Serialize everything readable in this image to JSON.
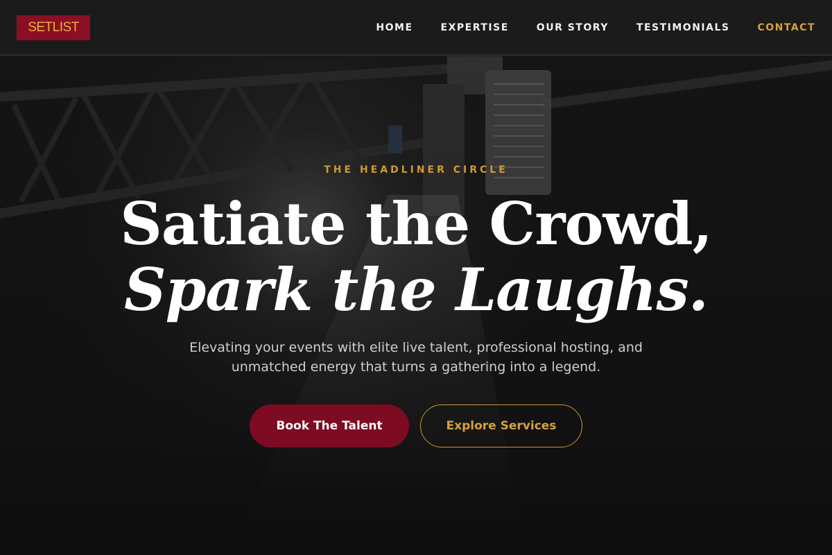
{
  "brand": {
    "logo_text": "SETLIST",
    "colors": {
      "logo_bg": "#8a0f24",
      "logo_text": "#e8b23a",
      "accent_gold": "#d6a13a",
      "primary_button": "#7d0b22",
      "background": "#161616"
    }
  },
  "nav": {
    "items": [
      {
        "label": "HOME",
        "active": false
      },
      {
        "label": "EXPERTISE",
        "active": false
      },
      {
        "label": "OUR STORY",
        "active": false
      },
      {
        "label": "TESTIMONIALS",
        "active": false
      },
      {
        "label": "CONTACT",
        "active": true
      }
    ]
  },
  "hero": {
    "kicker": "THE HEADLINER CIRCLE",
    "headline_line1": "Satiate the Crowd,",
    "headline_line2": "Spark the Laughs.",
    "subtext": "Elevating your events with elite live talent, professional hosting, and unmatched energy that turns a gathering into a legend.",
    "primary_cta": "Book The Talent",
    "secondary_cta": "Explore Services",
    "background_image": "stage-truss-spotlight-photo"
  }
}
